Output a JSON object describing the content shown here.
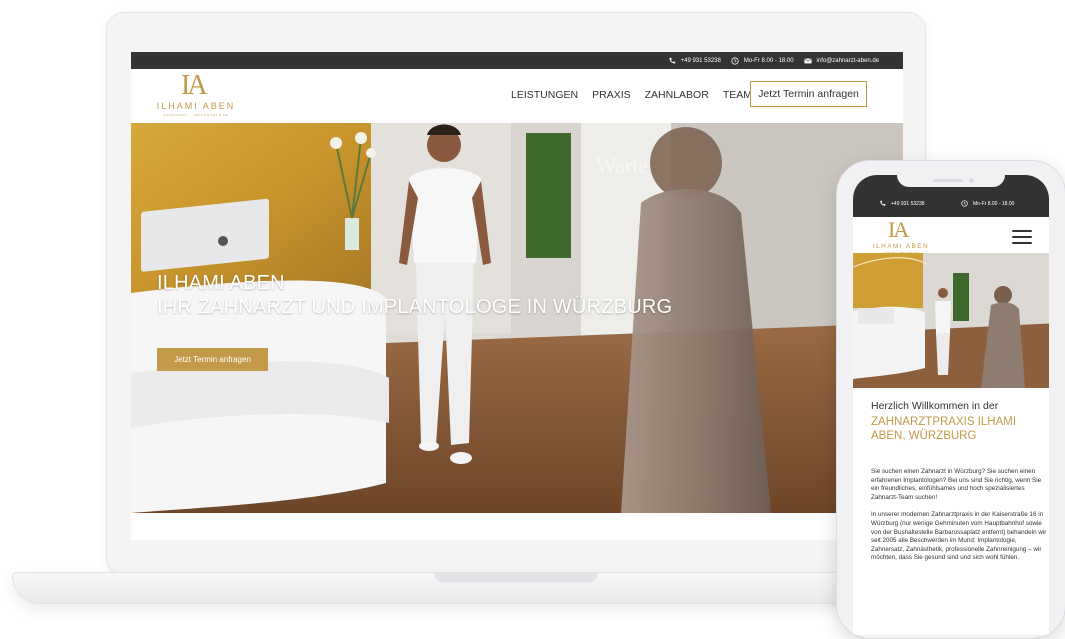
{
  "contact": {
    "phone": "+49 931 53238",
    "hours": "Mo-Fr 8.00 - 18.00",
    "email": "info@zahnarzt-aben.de"
  },
  "brand": {
    "monogram": "IA",
    "name": "ILHAMI ABEN",
    "tagline": "ZAHNARZT · IMPLANTOLOGE"
  },
  "nav": {
    "items": [
      "LEISTUNGEN",
      "PRAXIS",
      "ZAHNLABOR",
      "TEAM"
    ],
    "cta": "Jetzt Termin anfragen"
  },
  "hero": {
    "line1": "ILHAMI ABEN",
    "line2": "IHR ZAHNARZT UND IMPLANTOLOGE IN WÜRZBURG",
    "cta": "Jetzt Termin anfragen",
    "door_text": "Warte"
  },
  "mobile": {
    "phone": "+49 931 53238",
    "hours": "Mo-Fr 8.00 - 18.00",
    "welcome": "Herzlich Willkommen in der",
    "practice": "ZAHNARZTPRAXIS ILHAMI ABEN, WÜRZBURG",
    "paragraph1": "Sie suchen einen Zahnarzt in Würzburg? Sie suchen einen erfahrenen Implantologen? Bei uns sind Sie richtig, wenn Sie ein freundliches, einfühlsames und hoch spezialisiertes Zahnarzt-Team suchen!",
    "paragraph2": "In unserer modernen Zahnarztpraxis in der Kaiserstraße 16 in Würzburg (nur wenige Gehminuten vom Hauptbahnhof sowie von der Bushaltestelle Barbarossaplatz entfernt) behandeln wir seit 2005 alle Beschwerden im Mund: Implantologie, Zahnersatz, Zahnästhetik, professionelle Zahnreinigung – wir möchten, dass Sie gesund sind und sich wohl fühlen."
  },
  "icons": {
    "phone": "phone-icon",
    "clock": "clock-icon",
    "mail": "mail-icon",
    "menu": "hamburger-menu-icon"
  },
  "colors": {
    "gold": "#c29a48",
    "topbar": "#333333",
    "text": "#333333"
  }
}
